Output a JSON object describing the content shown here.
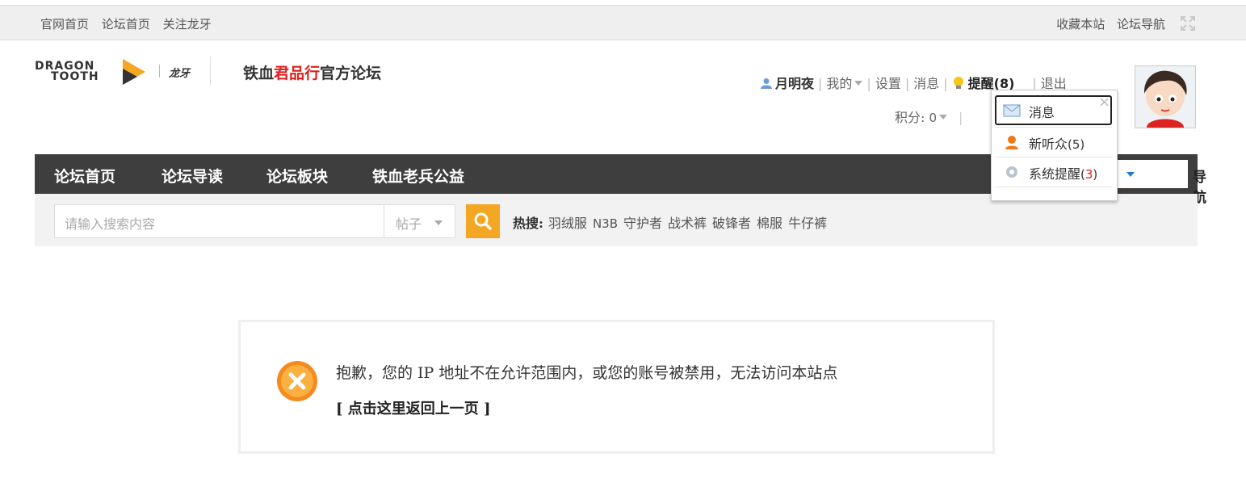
{
  "topbar": {
    "left_links": [
      "官网首页",
      "论坛首页",
      "关注龙牙"
    ],
    "right_links": [
      "收藏本站",
      "论坛导航"
    ],
    "fullscreen_icon": "fullscreen-icon"
  },
  "logo": {
    "dragon_line1": "DRAGON",
    "dragon_line2": "TOOTH",
    "longya": "龙牙",
    "title_prefix": "铁血",
    "title_highlight": "君品行",
    "title_suffix": "官方论坛",
    "accent": "#e01d1d",
    "arrow_color": "#f5a623"
  },
  "user": {
    "name": "月明夜",
    "my": "我的",
    "settings": "设置",
    "messages": "消息",
    "remind_label": "提醒",
    "remind_count": "(8)",
    "logout": "退出",
    "score_label": "积分: ",
    "score_value": "0"
  },
  "nav": {
    "items": [
      "论坛首页",
      "论坛导读",
      "论坛板块",
      "铁血老兵公益"
    ],
    "right_label": "导航",
    "bg": "#3e3e3e"
  },
  "search": {
    "placeholder": "请输入搜索内容",
    "type_selected": "帖子",
    "hot_label": "热搜:",
    "hot_terms": [
      "羽绒服",
      "N3B",
      "守护者",
      "战术裤",
      "破锋者",
      "棉服",
      "牛仔裤"
    ],
    "button_color": "#f5a623"
  },
  "message": {
    "text": "抱歉，您的 IP 地址不在允许范围内，或您的账号被禁用，无法访问本站点",
    "back_link": "[ 点击这里返回上一页 ]"
  },
  "dropdown": {
    "close": "×",
    "items": [
      {
        "label": "消息",
        "count": ""
      },
      {
        "label": "新听众",
        "count": "(5)"
      },
      {
        "label": "系统提醒",
        "count_open": "(",
        "count_num": "3",
        "count_close": ")"
      }
    ]
  }
}
